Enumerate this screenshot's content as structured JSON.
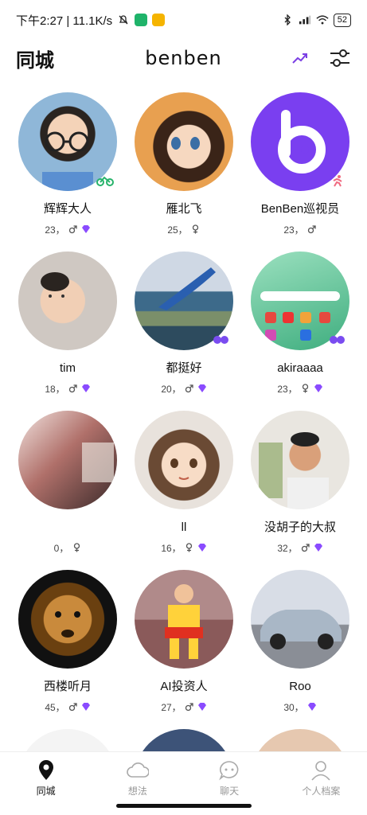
{
  "status_bar": {
    "time_text": "下午2:27 | 11.1K/s",
    "battery": "52"
  },
  "header": {
    "title": "同城",
    "logo": "benben"
  },
  "users": [
    {
      "name": "辉辉大人",
      "meta": "23，",
      "gender": "male",
      "gem": true,
      "badge": "bike-icon"
    },
    {
      "name": "雁北飞",
      "meta": "25，",
      "gender": "female",
      "gem": false,
      "badge": ""
    },
    {
      "name": "BenBen巡视员",
      "meta": "23，",
      "gender": "male",
      "gem": false,
      "badge": "runner-icon"
    },
    {
      "name": "tim",
      "meta": "18，",
      "gender": "male",
      "gem": true,
      "badge": ""
    },
    {
      "name": "都挺好",
      "meta": "20，",
      "gender": "male",
      "gem": true,
      "badge": "dots-icon"
    },
    {
      "name": "akiraaaa",
      "meta": "23，",
      "gender": "female",
      "gem": true,
      "badge": "dots-icon"
    },
    {
      "name": "",
      "meta": "0，",
      "gender": "female",
      "gem": false,
      "badge": ""
    },
    {
      "name": "ll",
      "meta": "16，",
      "gender": "female",
      "gem": true,
      "badge": ""
    },
    {
      "name": "没胡子的大叔",
      "meta": "32，",
      "gender": "male",
      "gem": true,
      "badge": ""
    },
    {
      "name": "西楼听月",
      "meta": "45，",
      "gender": "male",
      "gem": true,
      "badge": ""
    },
    {
      "name": "AI投资人",
      "meta": "27，",
      "gender": "male",
      "gem": true,
      "badge": ""
    },
    {
      "name": "Roo",
      "meta": "30，",
      "gender": "",
      "gem": true,
      "badge": ""
    }
  ],
  "nav": [
    {
      "label": "同城",
      "icon": "location-pin-icon",
      "active": true
    },
    {
      "label": "想法",
      "icon": "cloud-icon",
      "active": false
    },
    {
      "label": "聊天",
      "icon": "chat-icon",
      "active": false
    },
    {
      "label": "个人档案",
      "icon": "profile-icon",
      "active": false
    }
  ],
  "colors": {
    "accent": "#7b3fe4",
    "gem": "#8a4bff"
  }
}
